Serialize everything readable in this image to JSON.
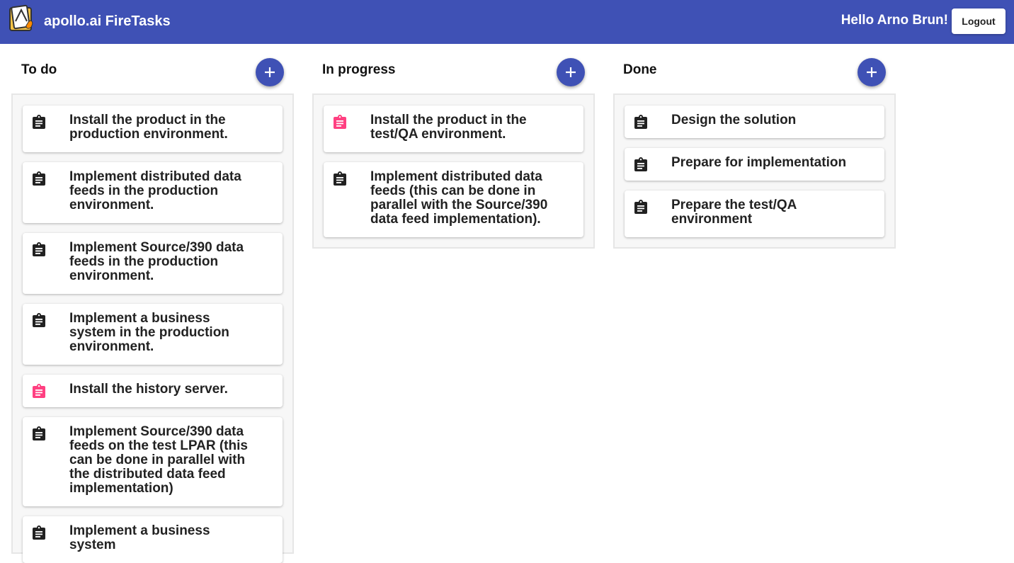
{
  "header": {
    "app_title": "apollo.ai FireTasks",
    "greeting": "Hello Arno Brun!",
    "logout_label": "Logout",
    "bg_color": "#3f51b5"
  },
  "accent_color": "#3f51b5",
  "highlight_icon_color": "#ff4081",
  "columns": [
    {
      "title": "To do",
      "cards": [
        {
          "text": "Install the product in the production environment.",
          "icon": "clipboard-icon",
          "highlighted": false
        },
        {
          "text": "Implement distributed data feeds in the production environment.",
          "icon": "clipboard-icon",
          "highlighted": false
        },
        {
          "text": "Implement Source/390 data feeds in the production environment.",
          "icon": "clipboard-icon",
          "highlighted": false
        },
        {
          "text": "Implement a business system in the production environment.",
          "icon": "clipboard-icon",
          "highlighted": false
        },
        {
          "text": "Install the history server.",
          "icon": "clipboard-icon",
          "highlighted": true
        },
        {
          "text": "Implement Source/390 data feeds on the test LPAR (this can be done in parallel with the distributed data feed implementation)",
          "icon": "clipboard-icon",
          "highlighted": false
        },
        {
          "text": "Implement a business system",
          "icon": "clipboard-icon",
          "highlighted": false
        }
      ]
    },
    {
      "title": "In progress",
      "cards": [
        {
          "text": "Install the product in the test/QA environment.",
          "icon": "clipboard-icon",
          "highlighted": true
        },
        {
          "text": "Implement distributed data feeds (this can be done in parallel with the Source/390 data feed implementation).",
          "icon": "clipboard-icon",
          "highlighted": false
        }
      ]
    },
    {
      "title": "Done",
      "cards": [
        {
          "text": "Design the solution",
          "icon": "clipboard-icon",
          "highlighted": false
        },
        {
          "text": "Prepare for implementation",
          "icon": "clipboard-icon",
          "highlighted": false
        },
        {
          "text": "Prepare the test/QA environment",
          "icon": "clipboard-icon",
          "highlighted": false
        }
      ]
    }
  ]
}
